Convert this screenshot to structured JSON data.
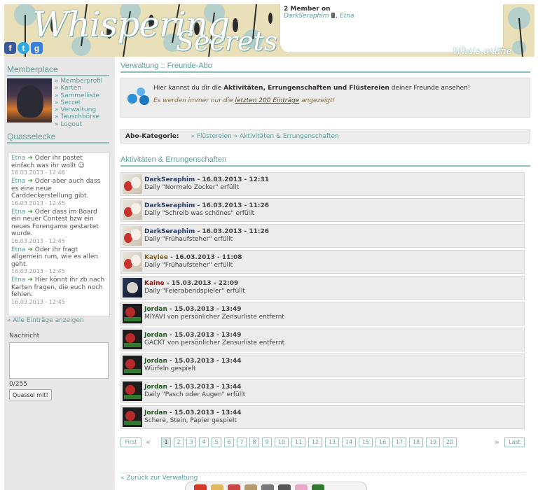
{
  "header": {
    "logo_text_1": "Whispering",
    "logo_text_2": "Secrets",
    "social": [
      {
        "icon": "facebook-icon",
        "glyph": "f",
        "color": "#3b5998"
      },
      {
        "icon": "twitter-icon",
        "glyph": "t",
        "color": "#2fa8e0"
      },
      {
        "icon": "google-icon",
        "glyph": "g",
        "color": "#3a7fd8"
      }
    ],
    "online": {
      "count_label": "2 Member on",
      "members": [
        "DarkSeraphim",
        "Etna"
      ],
      "member_icon": "phone-icon",
      "whos_online": "Who's online"
    }
  },
  "sidebar": {
    "memberplace_title": "Memberplace",
    "menu": [
      "Memberprofil",
      "Karten",
      "Sammelliste",
      "Secret",
      "Verwaltung",
      "Tauschbörse",
      "Logout"
    ],
    "quasselecke_title": "Quasselecke",
    "messages": [
      {
        "user": "Etna",
        "text": "Oder ihr postet einfach was ihr wollt",
        "date": "16.03.2013 - 12:46",
        "emoji": "smiley-icon"
      },
      {
        "user": "Etna",
        "text": "Oder aber auch dass es eine neue Carddeckerstellung gibt.",
        "date": "16.03.2013 - 12:45"
      },
      {
        "user": "Etna",
        "text": "Oder dass im Board ein neuer Contest bzw ein neues Forengame gestartet wurde.",
        "date": "16.03.2013 - 12:45"
      },
      {
        "user": "Etna",
        "text": "Oder ihr fragt allgemein rum, wie es allen geht.",
        "date": "16.03.2013 - 12:45"
      },
      {
        "user": "Etna",
        "text": "Hier könnt ihr zb nach Karten fragen, die euch noch fehlen.",
        "date": "16.03.2013 - 12:45"
      }
    ],
    "all_entries": "» Alle Einträge anzeigen",
    "nachricht_label": "Nachricht",
    "char_count": "0/255",
    "submit_label": "Quassel mit!"
  },
  "main": {
    "title": "Verwaltung :: Freunde-Abo",
    "info_prefix": "Hier kannst du dir die ",
    "info_bold": "Aktivitäten, Errungenschaften und Flüstereien",
    "info_suffix": " deiner Freunde ansehen!",
    "info_note_prefix": "Es werden immer nur die ",
    "info_note_link": "letzten 200 Einträge",
    "info_note_suffix": " angezeigt!",
    "abo_label": "Abo-Kategorie:",
    "abo_links": [
      "» Flüstereien",
      "» Aktivitäten & Errungenschaften"
    ],
    "section_title": "Aktivitäten & Errungenschaften",
    "feed": [
      {
        "user": "DarkSeraphim",
        "date": "16.03.2013 - 12:31",
        "action": "Daily \"Normalo Zocker\" erfüllt",
        "avatar": "ds"
      },
      {
        "user": "DarkSeraphim",
        "date": "16.03.2013 - 11:26",
        "action": "Daily \"Schreib was schönes\" erfüllt",
        "avatar": "ds"
      },
      {
        "user": "DarkSeraphim",
        "date": "16.03.2013 - 11:26",
        "action": "Daily \"Frühaufsteher\" erfüllt",
        "avatar": "ds"
      },
      {
        "user": "Kaylee",
        "date": "16.03.2013 - 11:08",
        "action": "Daily \"Frühaufsteher\" erfüllt",
        "avatar": "ds"
      },
      {
        "user": "Kaine",
        "date": "15.03.2013 - 22:09",
        "action": "Daily \"Feierabendspieler\" erfüllt",
        "avatar": "ka"
      },
      {
        "user": "Jordan",
        "date": "15.03.2013 - 13:49",
        "action": "MIYAVI von persönlicher Zensurliste entfernt",
        "avatar": "jo"
      },
      {
        "user": "Jordan",
        "date": "15.03.2013 - 13:49",
        "action": "GACKT von persönlicher Zensurliste entfernt",
        "avatar": "jo"
      },
      {
        "user": "Jordan",
        "date": "15.03.2013 - 13:44",
        "action": "Würfeln gespielt",
        "avatar": "jo"
      },
      {
        "user": "Jordan",
        "date": "15.03.2013 - 13:44",
        "action": "Daily \"Pasch oder Augen\" erfüllt",
        "avatar": "jo"
      },
      {
        "user": "Jordan",
        "date": "15.03.2013 - 13:44",
        "action": "Schere, Stein, Papier gespielt",
        "avatar": "jo"
      }
    ],
    "pager": {
      "first": "First",
      "last": "Last",
      "prev": "«",
      "next": "»",
      "current": "1",
      "pages": [
        "1",
        "2",
        "3",
        "4",
        "5",
        "6",
        "7",
        "8",
        "9",
        "10",
        "11",
        "12",
        "13",
        "14",
        "15",
        "16",
        "17",
        "18",
        "19",
        "20"
      ]
    },
    "back_link": "« Zurück zur Verwaltung"
  },
  "colors": {
    "accent": "#5b9e9a",
    "darkseraphim": "#2a3a6a",
    "kaylee": "#8a6418",
    "kaine": "#8a1a1a",
    "jordan": "#1f5a1f"
  }
}
